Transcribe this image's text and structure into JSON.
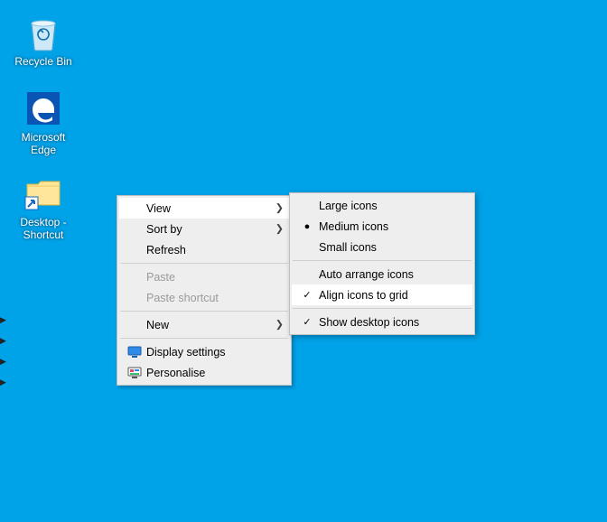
{
  "desktop_icons": {
    "recycle_bin": {
      "label": "Recycle Bin"
    },
    "edge": {
      "label": "Microsoft Edge"
    },
    "shortcut": {
      "label": "Desktop - Shortcut"
    }
  },
  "context_menu": {
    "view": "View",
    "sort_by": "Sort by",
    "refresh": "Refresh",
    "paste": "Paste",
    "paste_shortcut": "Paste shortcut",
    "new": "New",
    "display_settings": "Display settings",
    "personalise": "Personalise"
  },
  "view_submenu": {
    "large_icons": "Large icons",
    "medium_icons": "Medium icons",
    "small_icons": "Small icons",
    "auto_arrange": "Auto arrange icons",
    "align_to_grid": "Align icons to grid",
    "show_desktop_icons": "Show desktop icons"
  }
}
